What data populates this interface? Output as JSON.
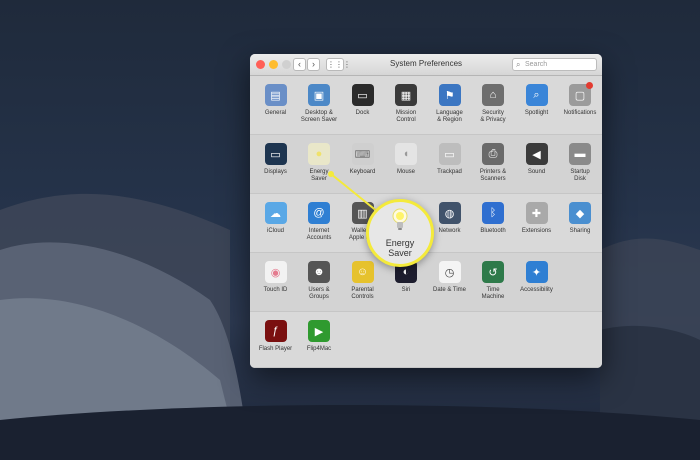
{
  "window": {
    "title": "System Preferences",
    "search_placeholder": "Search",
    "back": "‹",
    "forward": "›",
    "grid": "⋮⋮⋮"
  },
  "sections": [
    {
      "panes": [
        {
          "id": "general",
          "label": "General",
          "icon": "general-icon",
          "color": "#6a8fc7"
        },
        {
          "id": "desktop-screen-saver",
          "label": "Desktop &\nScreen Saver",
          "icon": "desktop-icon",
          "color": "#4c88c7"
        },
        {
          "id": "dock",
          "label": "Dock",
          "icon": "dock-icon",
          "color": "#2b2b2b"
        },
        {
          "id": "mission-control",
          "label": "Mission\nControl",
          "icon": "mission-control-icon",
          "color": "#3a3a3a"
        },
        {
          "id": "language-region",
          "label": "Language\n& Region",
          "icon": "flag-icon",
          "color": "#3b76c2"
        },
        {
          "id": "security-privacy",
          "label": "Security\n& Privacy",
          "icon": "house-lock-icon",
          "color": "#6e6e6e"
        },
        {
          "id": "spotlight",
          "label": "Spotlight",
          "icon": "magnifier-icon",
          "color": "#3a85d8"
        },
        {
          "id": "notifications",
          "label": "Notifications",
          "icon": "notifications-icon",
          "color": "#9b9b9b"
        }
      ]
    },
    {
      "panes": [
        {
          "id": "displays",
          "label": "Displays",
          "icon": "monitor-icon",
          "color": "#1e3550"
        },
        {
          "id": "energy-saver",
          "label": "Energy\nSaver",
          "icon": "lightbulb-icon",
          "color": "#e9e7c9"
        },
        {
          "id": "keyboard",
          "label": "Keyboard",
          "icon": "keyboard-icon",
          "color": "#cfcfcf"
        },
        {
          "id": "mouse",
          "label": "Mouse",
          "icon": "mouse-icon",
          "color": "#e4e4e4"
        },
        {
          "id": "trackpad",
          "label": "Trackpad",
          "icon": "trackpad-icon",
          "color": "#bdbdbd"
        },
        {
          "id": "printers-scanners",
          "label": "Printers &\nScanners",
          "icon": "printer-icon",
          "color": "#6a6a6a"
        },
        {
          "id": "sound",
          "label": "Sound",
          "icon": "speaker-icon",
          "color": "#3b3b3b"
        },
        {
          "id": "startup-disk",
          "label": "Startup\nDisk",
          "icon": "disk-icon",
          "color": "#8a8a8a"
        }
      ]
    },
    {
      "panes": [
        {
          "id": "icloud",
          "label": "iCloud",
          "icon": "cloud-icon",
          "color": "#5aa8e6"
        },
        {
          "id": "internet-accounts",
          "label": "Internet\nAccounts",
          "icon": "at-icon",
          "color": "#2f7fd3"
        },
        {
          "id": "wallet-apple-pay",
          "label": "Wallet &\nApple Pay",
          "icon": "wallet-icon",
          "color": "#555555"
        },
        {
          "id": "touch-id-hidden",
          "label": "",
          "icon": "hidden-icon",
          "color": "#d9d9d9"
        },
        {
          "id": "network",
          "label": "Network",
          "icon": "globe-icon",
          "color": "#41536b"
        },
        {
          "id": "bluetooth",
          "label": "Bluetooth",
          "icon": "bluetooth-icon",
          "color": "#2f6fd0"
        },
        {
          "id": "extensions",
          "label": "Extensions",
          "icon": "puzzle-icon",
          "color": "#a9a9a9"
        },
        {
          "id": "sharing",
          "label": "Sharing",
          "icon": "sharing-icon",
          "color": "#4a8fd0"
        }
      ]
    },
    {
      "panes": [
        {
          "id": "touch-id",
          "label": "Touch ID",
          "icon": "fingerprint-icon",
          "color": "#f2f2f2"
        },
        {
          "id": "users-groups",
          "label": "Users &\nGroups",
          "icon": "users-icon",
          "color": "#555555"
        },
        {
          "id": "parental-controls",
          "label": "Parental\nControls",
          "icon": "parental-icon",
          "color": "#e6c22d"
        },
        {
          "id": "siri",
          "label": "Siri",
          "icon": "siri-icon",
          "color": "#1d1d2e"
        },
        {
          "id": "date-time",
          "label": "Date & Time",
          "icon": "clock-icon",
          "color": "#f4f4f4"
        },
        {
          "id": "time-machine",
          "label": "Time\nMachine",
          "icon": "time-machine-icon",
          "color": "#2e7a4a"
        },
        {
          "id": "accessibility",
          "label": "Accessibility",
          "icon": "accessibility-icon",
          "color": "#2f7fd3"
        }
      ]
    },
    {
      "panes": [
        {
          "id": "flash-player",
          "label": "Flash Player",
          "icon": "flash-icon",
          "color": "#7a1010"
        },
        {
          "id": "flip4mac",
          "label": "Flip4Mac",
          "icon": "play-icon",
          "color": "#2f9a2f"
        }
      ]
    }
  ],
  "callout": {
    "label": "Energy\nSaver",
    "accent": "#f4ea3b"
  }
}
